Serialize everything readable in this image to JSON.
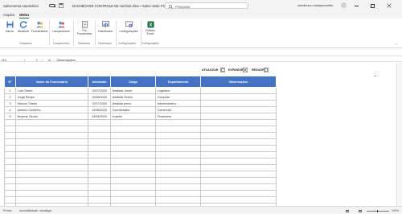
{
  "titlebar": {
    "autosave_label": "Salvamento Automático",
    "document_title": "DASHBOARD CONTROLE DE Senhas.xlsm • Salvo neste PC",
    "search_placeholder": "Pesquisar",
    "user_name": "wanderson mariquecoelito",
    "window_controls": [
      "minimize",
      "maximize",
      "close"
    ]
  },
  "menu": {
    "tabs": [
      {
        "label": "Arquivo",
        "active": false
      },
      {
        "label": "MENU",
        "active": true
      }
    ]
  },
  "ribbon": {
    "buttons": [
      {
        "label": "Salvar",
        "icon": "save-icon"
      },
      {
        "label": "Atualizar",
        "icon": "refresh-icon"
      },
      {
        "label": "Funcionários",
        "icon": "people-icon"
      },
      {
        "label": "Lançamentos",
        "icon": "people-icon"
      },
      {
        "label": "Por Funcionário",
        "icon": "report-icon"
      },
      {
        "label": "Dashboard",
        "icon": "dashboard-icon"
      },
      {
        "label": "Configurações",
        "icon": "settings-icon"
      },
      {
        "label": "Ribbon Excel",
        "icon": "excel-icon"
      }
    ],
    "groups": [
      "Cadastros",
      "Lançamentos",
      "Relatórios",
      "Dashboard",
      "Configurações",
      "Configurações"
    ]
  },
  "formula_bar": {
    "cell_ref": "I13",
    "fx": "fx",
    "value": "Observações"
  },
  "actions": [
    {
      "label": "ATUALIZAR",
      "icon": "refresh-icon"
    },
    {
      "label": "EXPANDIR",
      "icon": "expand-icon"
    },
    {
      "label": "REDUZIR",
      "icon": "collapse-icon"
    }
  ],
  "table": {
    "headers": [
      "Nº",
      "Nome do Funcionário",
      "Admissão",
      "Cargo",
      "Departamento",
      "Observações"
    ],
    "rows": [
      [
        "1",
        "Luis Otavio",
        "12/07/2020",
        "Analista Junior",
        "Logística",
        ""
      ],
      [
        "2",
        "Jorge Benjor",
        "12/06/2020",
        "Analista Senior",
        "Compras",
        ""
      ],
      [
        "3",
        "Marcos Toledo",
        "12/07/2020",
        "Analista pleno",
        "Administrativo",
        ""
      ],
      [
        "4",
        "Antônio Coutinho",
        "13/08/2020",
        "Coordenador",
        "Comercial",
        ""
      ],
      [
        "5",
        "Neymar Osorio",
        "14/06/2020",
        "Impetor",
        "Financeiro",
        ""
      ],
      [
        "",
        "",
        "",
        "",
        "",
        ""
      ],
      [
        "",
        "",
        "",
        "",
        "",
        ""
      ],
      [
        "",
        "",
        "",
        "",
        "",
        ""
      ],
      [
        "",
        "",
        "",
        "",
        "",
        ""
      ],
      [
        "",
        "",
        "",
        "",
        "",
        ""
      ],
      [
        "",
        "",
        "",
        "",
        "",
        ""
      ],
      [
        "",
        "",
        "",
        "",
        "",
        ""
      ],
      [
        "",
        "",
        "",
        "",
        "",
        ""
      ],
      [
        "",
        "",
        "",
        "",
        "",
        ""
      ],
      [
        "",
        "",
        "",
        "",
        "",
        ""
      ],
      [
        "",
        "",
        "",
        "",
        "",
        ""
      ],
      [
        "",
        "",
        "",
        "",
        "",
        ""
      ],
      [
        "",
        "",
        "",
        "",
        "",
        ""
      ],
      [
        "",
        "",
        "",
        "",
        "",
        ""
      ]
    ]
  },
  "statusbar": {
    "mode": "Pronto",
    "accessibility": "Acessibilidade: investigar",
    "zoom": "100%"
  },
  "colors": {
    "header_blue": "#4472c4",
    "excel_green": "#217346"
  }
}
